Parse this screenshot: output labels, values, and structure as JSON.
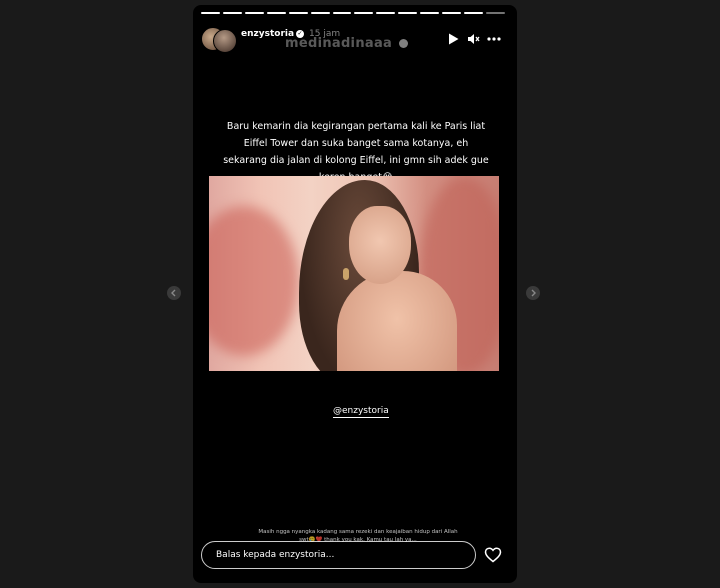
{
  "story": {
    "progress_segments": 14,
    "owner_username": "enzystoria",
    "time_ago": "15 jam",
    "reposted_username": "medinadinaaa",
    "caption": "Baru kemarin dia kegirangan pertama kali ke Paris liat Eiffel Tower dan suka banget sama kotanya, eh sekarang dia jalan di kolong Eiffel, ini gmn sih adek gue keren banget😭",
    "mention": "@enzystoria",
    "overlay_text": "Masih ngga nyangka kadang sama rezeki dan keajaiban hidup dari Allah swt🥲❤️ thank you kak. Kamu tau lah ya...",
    "reply_placeholder": "Balas kepada enzystoria..."
  },
  "icons": {
    "play": "play-icon",
    "mute": "speaker-muted-icon",
    "more": "more-options-icon",
    "like": "heart-icon",
    "prev": "chevron-left-icon",
    "next": "chevron-right-icon"
  }
}
